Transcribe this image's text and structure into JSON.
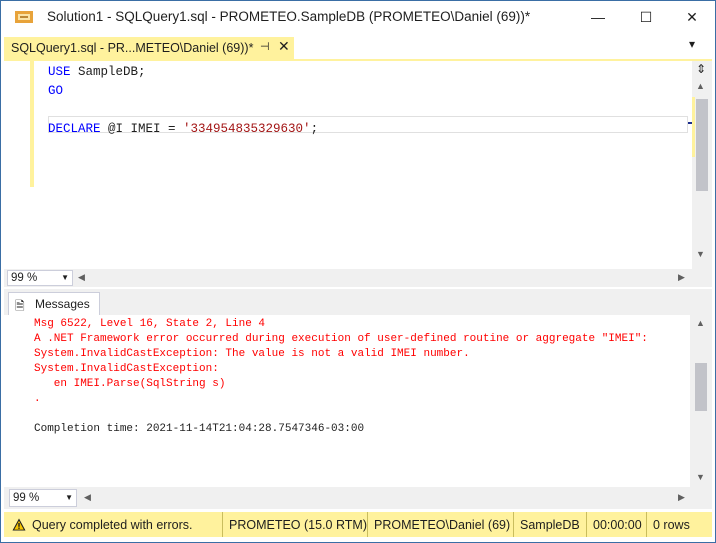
{
  "window": {
    "title": "Solution1 - SQLQuery1.sql - PROMETEO.SampleDB (PROMETEO\\Daniel (69))*",
    "minimize_glyph": "—",
    "maximize_glyph": "☐",
    "close_glyph": "✕"
  },
  "tab": {
    "label": "SQLQuery1.sql - PR...METEO\\Daniel (69))*",
    "pin_glyph": "⊣",
    "close_glyph": "✕",
    "overflow_glyph": "▾"
  },
  "editor": {
    "lines": [
      {
        "k1": "USE",
        "rest": " SampleDB;"
      },
      {
        "k1": "GO",
        "rest": ""
      },
      {
        "k1": "",
        "rest": ""
      },
      {
        "k1": "DECLARE",
        "mid": " @I IMEI = ",
        "str": "'334954835329630'",
        "end": ";"
      }
    ]
  },
  "zoom": {
    "editor": "99 %",
    "messages": "99 %"
  },
  "results": {
    "messages_tab": "Messages"
  },
  "messages": {
    "lines": [
      "Msg 6522, Level 16, State 2, Line 4",
      "A .NET Framework error occurred during execution of user-defined routine or aggregate \"IMEI\":",
      "System.InvalidCastException: The value is not a valid IMEI number.",
      "System.InvalidCastException:",
      "   en IMEI.Parse(SqlString s)",
      "."
    ],
    "completion": "Completion time: 2021-11-14T21:04:28.7547346-03:00"
  },
  "status": {
    "message": "Query completed with errors.",
    "server": "PROMETEO (15.0 RTM)",
    "user": "PROMETEO\\Daniel (69)",
    "database": "SampleDB",
    "time": "00:00:00",
    "rows": "0 rows"
  },
  "colors": {
    "accent_yellow": "#fff29d",
    "keyword_blue": "#0000ff",
    "string_red": "#a31515",
    "error_red": "#ff0000"
  },
  "icons": {
    "app": "ssms-app-icon",
    "split": "split-editor-icon",
    "messages": "messages-icon",
    "warning": "warning-icon"
  }
}
